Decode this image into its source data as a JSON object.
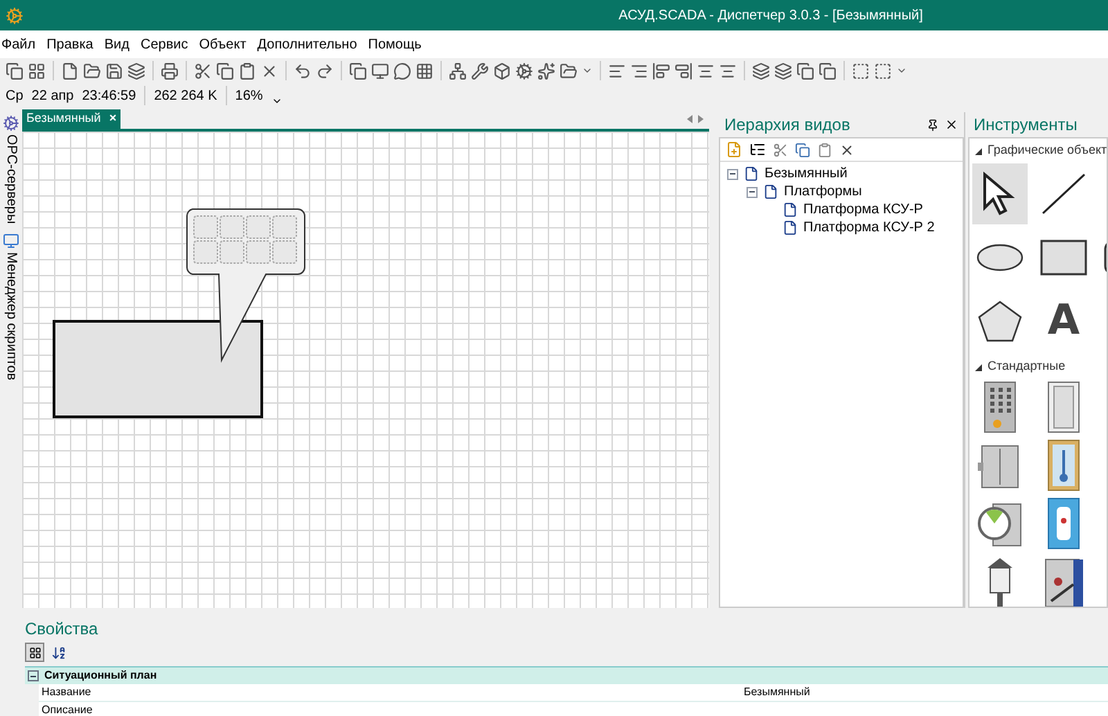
{
  "window": {
    "title": "АСУД.SCADA - Диспетчер 3.0.3 - [Безымянный]"
  },
  "menu": [
    "Файл",
    "Правка",
    "Вид",
    "Сервис",
    "Объект",
    "Дополнительно",
    "Помощь"
  ],
  "status_toolbar": {
    "day": "Ср",
    "date": "22 апр",
    "time": "23:46:59",
    "memory": "262 264 K",
    "zoom": "16%"
  },
  "side_tabs": [
    {
      "label": "OPC-серверы"
    },
    {
      "label": "Менеджер скриптов"
    }
  ],
  "document_tabs": [
    {
      "label": "Безымянный",
      "selected": true,
      "close": "×"
    }
  ],
  "hierarchy": {
    "title": "Иерархия видов",
    "tree": [
      {
        "label": "Безымянный",
        "expanded": true,
        "children": [
          {
            "label": "Платформы",
            "expanded": true,
            "children": [
              {
                "label": "Платформа КСУ-Р"
              },
              {
                "label": "Платформа КСУ-Р 2"
              }
            ]
          }
        ]
      }
    ]
  },
  "tools": {
    "title": "Инструменты",
    "sections": [
      {
        "label": "Графические объект",
        "expanded": true,
        "rows": [
          [
            {
              "kind": "pointer",
              "selected": true
            },
            {
              "kind": "line",
              "selected": false
            }
          ],
          [
            {
              "kind": "ellipse",
              "selected": false
            },
            {
              "kind": "rectangle",
              "selected": false
            },
            {
              "kind": "rounded",
              "selected": false
            }
          ],
          [
            {
              "kind": "pentagon",
              "selected": false
            },
            {
              "kind": "text",
              "glyph": "A",
              "selected": false
            }
          ]
        ]
      },
      {
        "label": "Стандартные",
        "expanded": true,
        "rows": [
          [
            {
              "kind": "panel",
              "selected": false
            },
            {
              "kind": "door",
              "selected": false
            }
          ],
          [
            {
              "kind": "cabinet",
              "selected": false
            },
            {
              "kind": "thermometer",
              "selected": false
            }
          ],
          [
            {
              "kind": "gauge",
              "selected": false
            },
            {
              "kind": "heater",
              "selected": false
            }
          ],
          [
            {
              "kind": "lamp",
              "selected": false
            },
            {
              "kind": "switch",
              "selected": false
            }
          ]
        ]
      }
    ]
  },
  "properties": {
    "title": "Свойства",
    "view_buttons": [
      {
        "kind": "categorized",
        "selected": true
      },
      {
        "kind": "alphabetical",
        "selected": false
      }
    ],
    "groups": [
      {
        "label": "Ситуационный план",
        "expanded": true,
        "rows": [
          {
            "name": "Название",
            "value": "Безымянный"
          },
          {
            "name": "Описание"
          }
        ]
      }
    ]
  }
}
